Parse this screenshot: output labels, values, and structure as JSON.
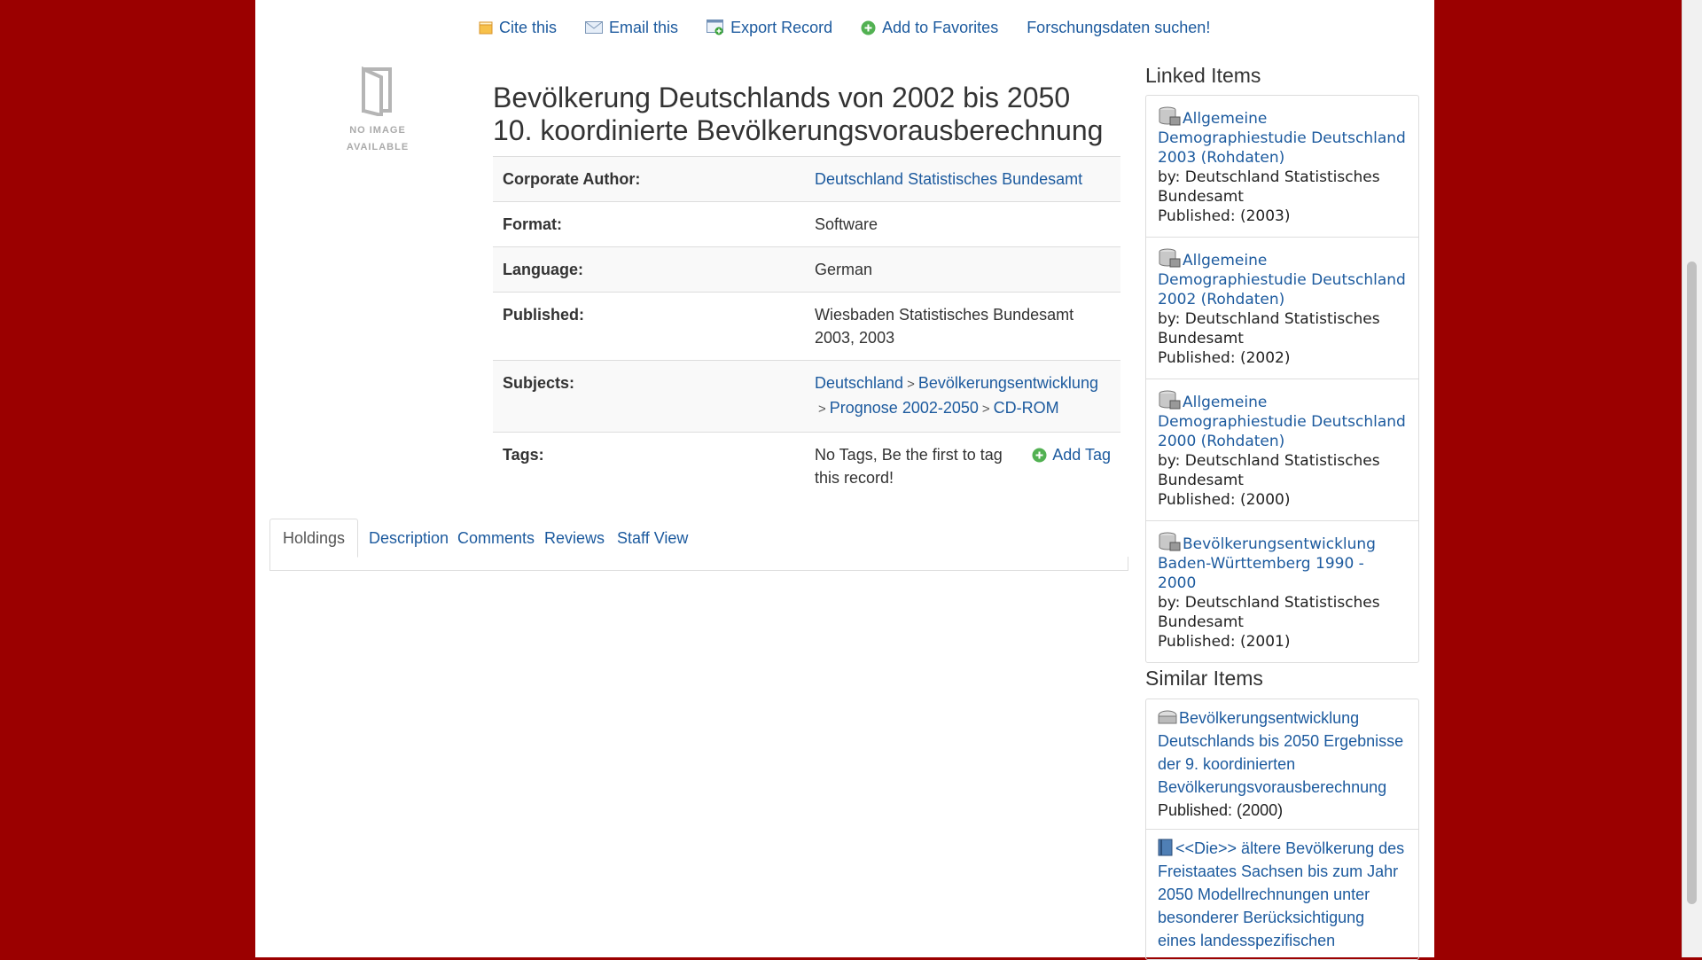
{
  "toolbar": {
    "cite": "Cite this",
    "email": "Email this",
    "export": "Export Record",
    "favorites": "Add to Favorites",
    "research": "Forschungsdaten suchen!"
  },
  "cover": {
    "line1": "NO IMAGE",
    "line2": "AVAILABLE"
  },
  "record": {
    "title_line1": "Bevölkerung Deutschlands von 2002 bis 2050",
    "title_line2": "10. koordinierte Bevölkerungsvorausberechnung",
    "corporate_author_label": "Corporate Author:",
    "corporate_author": "Deutschland Statistisches Bundesamt",
    "format_label": "Format:",
    "format": "Software",
    "language_label": "Language:",
    "language": "German",
    "published_label": "Published:",
    "published": "Wiesbaden Statistisches Bundesamt 2003, 2003",
    "subjects_label": "Subjects:",
    "subjects": [
      "Deutschland",
      "Bevölkerungsentwicklung",
      "Prognose 2002-2050",
      "CD-ROM"
    ],
    "tags_label": "Tags:",
    "tags_text": "No Tags, Be the first to tag this record!",
    "add_tag": "Add Tag"
  },
  "tabs": [
    "Holdings",
    "Description",
    "Comments",
    "Reviews",
    "Staff View"
  ],
  "linked": {
    "heading": "Linked Items",
    "items": [
      {
        "title": "Allgemeine Demographiestudie Deutschland 2003 (Rohdaten)",
        "by": "by: Deutschland Statistisches Bundesamt",
        "published": "Published: (2003)"
      },
      {
        "title": "Allgemeine Demographiestudie Deutschland 2002 (Rohdaten)",
        "by": "by: Deutschland Statistisches Bundesamt",
        "published": "Published: (2002)"
      },
      {
        "title": "Allgemeine Demographiestudie Deutschland 2000 (Rohdaten)",
        "by": "by: Deutschland Statistisches Bundesamt",
        "published": "Published: (2000)"
      },
      {
        "title": "Bevölkerungsentwicklung Baden-Württemberg 1990 - 2000",
        "by": "by: Deutschland Statistisches Bundesamt",
        "published": "Published: (2001)"
      }
    ]
  },
  "similar": {
    "heading": "Similar Items",
    "items": [
      {
        "title": "Bevölkerungsentwicklung Deutschlands bis 2050 Ergebnisse der 9. koordinierten Bevölkerungsvorausberechnung",
        "published": "Published: (2000)"
      },
      {
        "title": "<<Die>> ältere Bevölkerung des Freistaates Sachsen bis zum Jahr 2050 Modellrechnungen unter besonderer Berücksichtigung eines landesspezifischen",
        "published": ""
      }
    ]
  },
  "colors": {
    "background": "#9b0000",
    "link": "#1c5a9e",
    "text": "#333333"
  }
}
